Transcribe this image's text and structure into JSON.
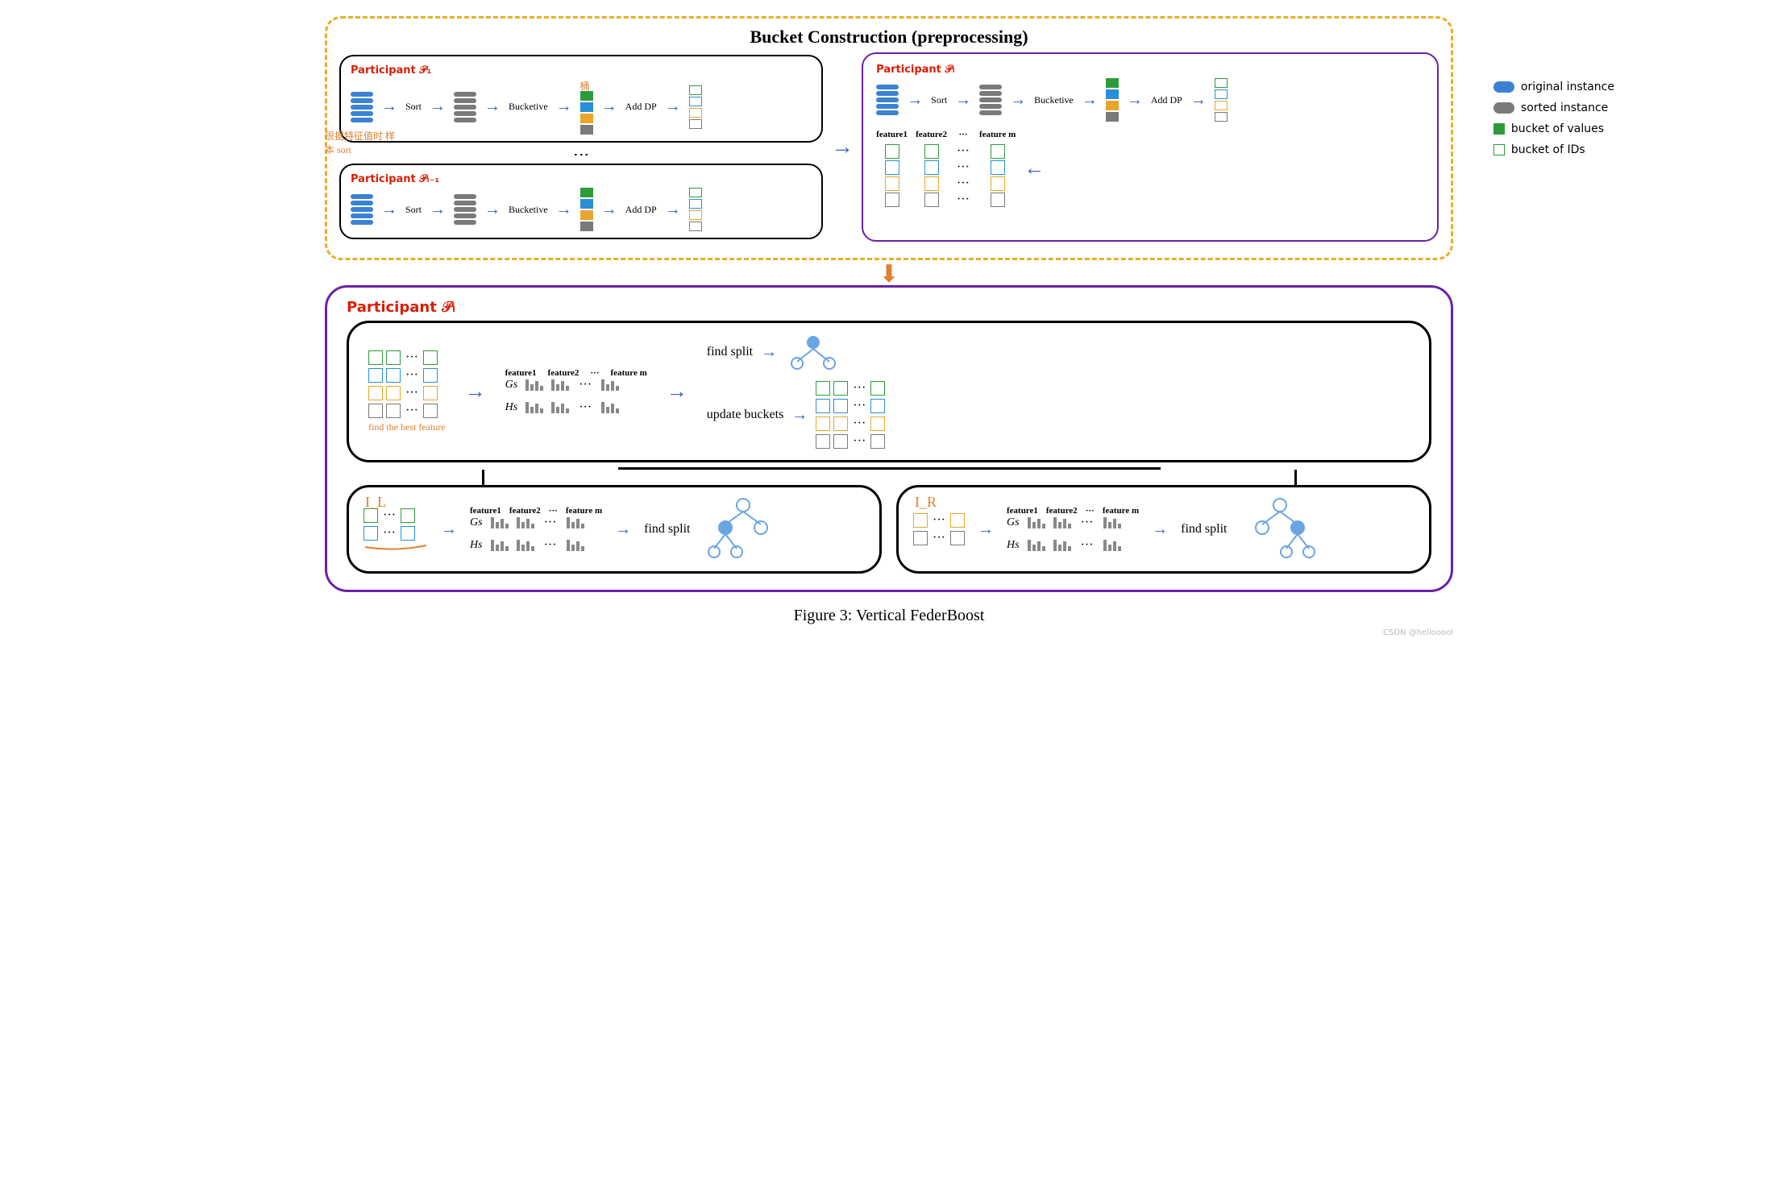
{
  "title": "Bucket Construction (preprocessing)",
  "participants": {
    "p1_label": "Participant 𝒫₁",
    "plm1_label": "Participant 𝒫ₗ₋₁",
    "pl_label": "Participant 𝒫ₗ"
  },
  "steps": {
    "sort": "Sort",
    "bucketize": "Bucketive",
    "add_dp": "Add DP"
  },
  "annotations": {
    "orange_top": "桶",
    "orange_sort_note": "很据特征值时 样本 sort",
    "best_feature": "find the best feature",
    "IL": "I_L",
    "IR": "I_R"
  },
  "feature_headers": {
    "f1": "feature1",
    "f2": "feature2",
    "dots": "···",
    "fm": "feature m"
  },
  "gs_hs": {
    "Gs": "Gs",
    "Hs": "Hs"
  },
  "actions": {
    "find_split": "find split",
    "update_buckets": "update buckets"
  },
  "legend": {
    "original": "original instance",
    "sorted": "sorted instance",
    "bucket_values": "bucket of values",
    "bucket_ids": "bucket of IDs"
  },
  "caption": "Figure 3: Vertical FederBoost",
  "watermark": "CSDN @hellooool"
}
